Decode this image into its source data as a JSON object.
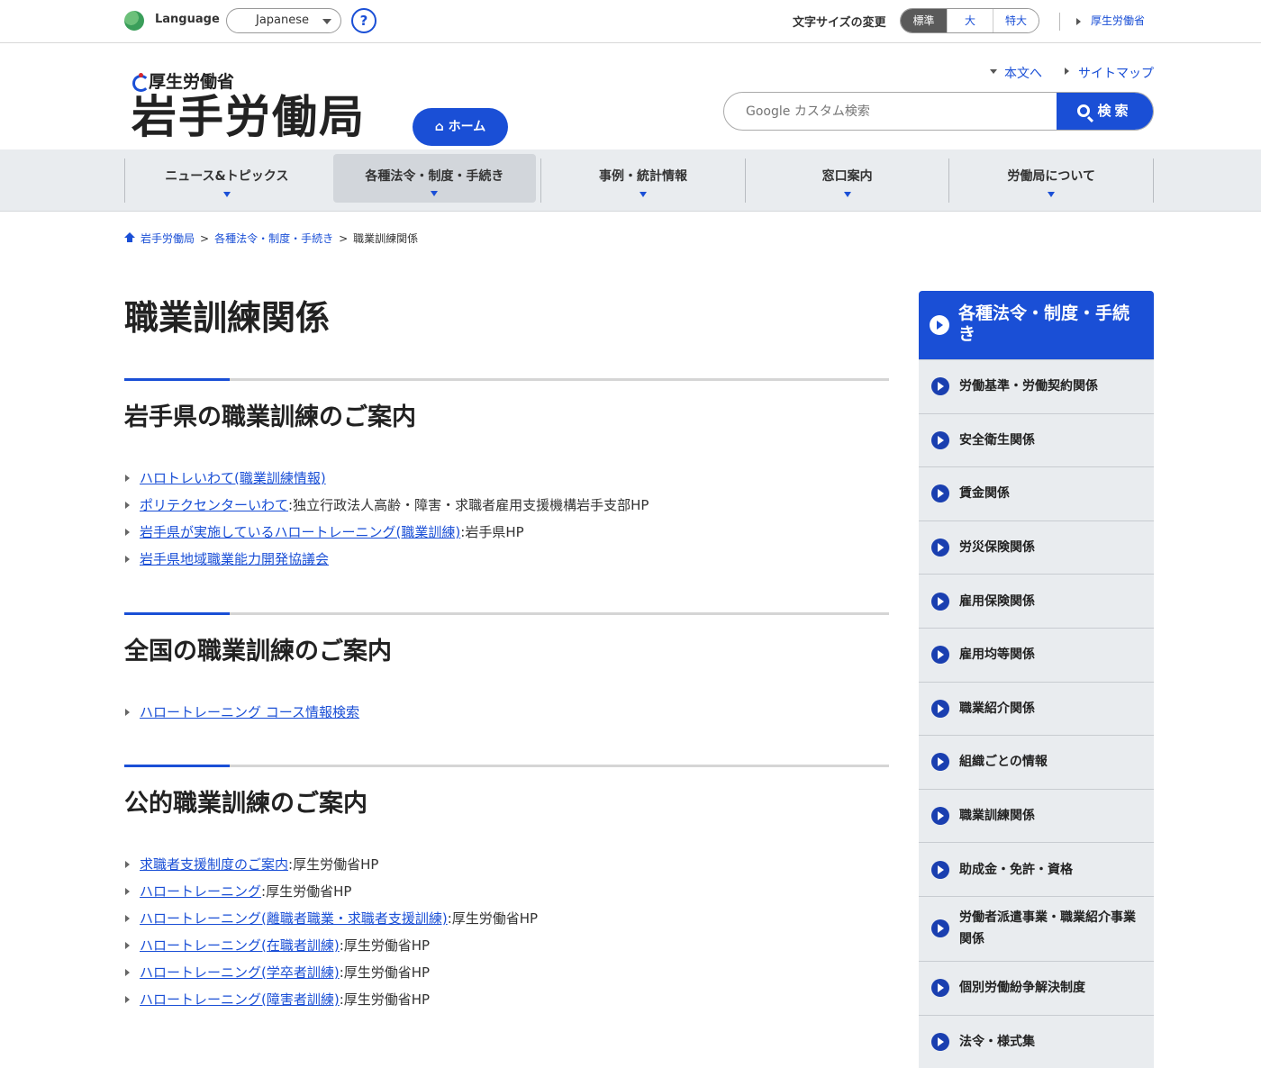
{
  "topbar": {
    "language_label": "Language",
    "language_value": "Japanese",
    "help_label": "?",
    "fontsize_label": "文字サイズの変更",
    "fontsize_options": [
      "標準",
      "大",
      "特大"
    ],
    "mhlw_link": "厚生労働省"
  },
  "header": {
    "ministry": "厚生労働省",
    "bureau": "岩手労働局",
    "home_button": "ホーム",
    "skip_main": "本文へ",
    "sitemap": "サイトマップ",
    "search_placeholder": "Google カスタム検索",
    "search_button": "検索"
  },
  "gnav": [
    {
      "label": "ニュース&トピックス"
    },
    {
      "label": "各種法令・制度・手続き"
    },
    {
      "label": "事例・統計情報"
    },
    {
      "label": "窓口案内"
    },
    {
      "label": "労働局について"
    }
  ],
  "breadcrumb": {
    "items": [
      "岩手労働局",
      "各種法令・制度・手続き"
    ],
    "current": "職業訓練関係",
    "separator": ">"
  },
  "main": {
    "title": "職業訓練関係",
    "sections": [
      {
        "heading": "岩手県の職業訓練のご案内",
        "items": [
          {
            "link": "ハロトレいわて(職業訓練情報)",
            "suffix": ""
          },
          {
            "link": "ポリテクセンターいわて",
            "suffix": ":独立行政法人高齢・障害・求職者雇用支援機構岩手支部HP"
          },
          {
            "link": "岩手県が実施しているハロートレーニング(職業訓練)",
            "suffix": ":岩手県HP"
          },
          {
            "link": "岩手県地域職業能力開発協議会",
            "suffix": ""
          }
        ]
      },
      {
        "heading": "全国の職業訓練のご案内",
        "items": [
          {
            "link": "ハロートレーニング コース情報検索",
            "suffix": ""
          }
        ]
      },
      {
        "heading": "公的職業訓練のご案内",
        "items": [
          {
            "link": "求職者支援制度のご案内",
            "suffix": ":厚生労働省HP"
          },
          {
            "link": "ハロートレーニング",
            "suffix": ":厚生労働省HP"
          },
          {
            "link": "ハロートレーニング(離職者職業・求職者支援訓練)",
            "suffix": ":厚生労働省HP"
          },
          {
            "link": "ハロートレーニング(在職者訓練)",
            "suffix": ":厚生労働省HP"
          },
          {
            "link": "ハロートレーニング(学卒者訓練)",
            "suffix": ":厚生労働省HP"
          },
          {
            "link": "ハロートレーニング(障害者訓練)",
            "suffix": ":厚生労働省HP"
          }
        ]
      }
    ]
  },
  "sidenav": {
    "heading": "各種法令・制度・手続き",
    "items": [
      "労働基準・労働契約関係",
      "安全衛生関係",
      "賃金関係",
      "労災保険関係",
      "雇用保険関係",
      "雇用均等関係",
      "職業紹介関係",
      "組織ごとの情報",
      "職業訓練関係",
      "助成金・免許・資格",
      "労働者派遣事業・職業紹介事業関係",
      "個別労働紛争解決制度",
      "法令・様式集"
    ]
  },
  "colors": {
    "accent": "#1a4fd6",
    "nav_bg": "#e9ecef"
  }
}
